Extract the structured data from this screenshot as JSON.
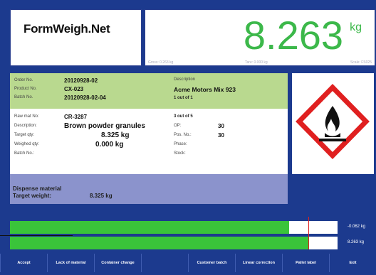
{
  "logo": {
    "text": "FormWeigh.Net"
  },
  "weight": {
    "value": "8.263",
    "unit": "kg",
    "gross": "Gross: 0.263 kg",
    "tare": "Tare: 0.000 kg",
    "scale": "Scale: FS025"
  },
  "order": {
    "order_no_label": "Order No.",
    "order_no": "20120928-02",
    "product_no_label": "Product No.",
    "product_no": "CX-023",
    "batch_no_label": "Batch No.",
    "batch_no": "20120928-02-04",
    "description_label": "Description",
    "description": "Acme Motors Mix 923",
    "count": "1 out of 1"
  },
  "material": {
    "raw_label": "Raw mat No:",
    "raw": "CR-3287",
    "desc_label": "Description:",
    "desc": "Brown powder granules",
    "target_label": "Target qty:",
    "target": "8.325 kg",
    "weighed_label": "Weighed qty:",
    "weighed": "0.000 kg",
    "batch_label": "Batch No.:",
    "count": "3 out of 5",
    "op_label": "OP:",
    "op": "30",
    "pos_label": "Pos. No.:",
    "pos": "30",
    "phase_label": "Phase:",
    "stock_label": "Stock:"
  },
  "dispense": {
    "title": "Dispense material",
    "target_label": "Target weight:",
    "target": "8.325 kg"
  },
  "bars": {
    "diff": "-0.062 kg",
    "current": "8.263 kg",
    "progress": 0.99
  },
  "buttons": [
    "Accept",
    "Lack of material",
    "Container change",
    "",
    "Customer batch",
    "Linear correction",
    "Pallet label",
    "Exit"
  ],
  "colors": {
    "accent": "#3cb84a",
    "frame": "#1c3a8e",
    "hazard": "#e02020"
  }
}
